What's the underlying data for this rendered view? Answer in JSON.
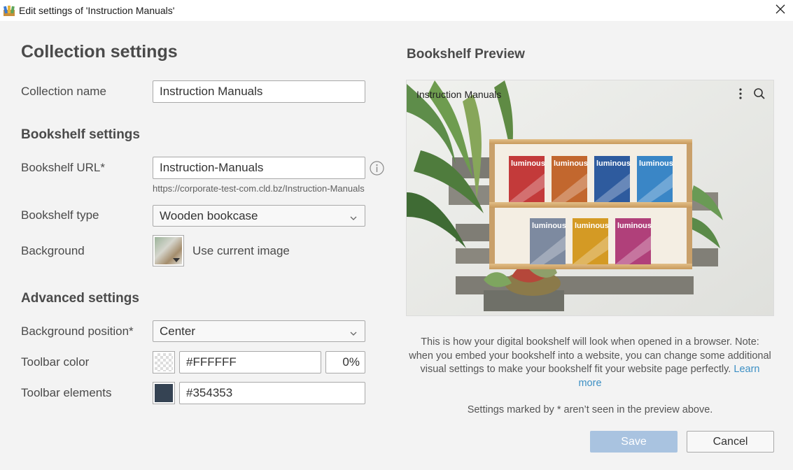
{
  "window": {
    "title": "Edit settings of 'Instruction Manuals'",
    "app_icon": "bookshelf-app-icon",
    "close_icon": "close-icon"
  },
  "form": {
    "heading": "Collection settings",
    "collection_name": {
      "label": "Collection name",
      "value": "Instruction Manuals"
    },
    "bookshelf_section": "Bookshelf settings",
    "bookshelf_url": {
      "label": "Bookshelf URL*",
      "value": "Instruction-Manuals",
      "helper": "https://corporate-test-com.cld.bz/Instruction-Manuals",
      "info_icon": "info-icon"
    },
    "bookshelf_type": {
      "label": "Bookshelf type",
      "value": "Wooden bookcase"
    },
    "background": {
      "label": "Background",
      "option": "Use current image"
    },
    "advanced_section": "Advanced settings",
    "background_position": {
      "label": "Background position*",
      "value": "Center"
    },
    "toolbar_color": {
      "label": "Toolbar color",
      "value": "#FFFFFF",
      "opacity": "0%",
      "swatch": "transparent"
    },
    "toolbar_elements": {
      "label": "Toolbar elements",
      "value": "#354353",
      "swatch": "#354353"
    }
  },
  "preview": {
    "heading": "Bookshelf Preview",
    "collection_name": "Instruction Manuals",
    "more_icon": "more-vertical-icon",
    "search_icon": "search-icon",
    "book_brand": "luminous",
    "book_colors_top": [
      "#c33a3a",
      "#c2672e",
      "#2e5b9e",
      "#3a86c6"
    ],
    "book_colors_bottom": [
      "#7d8aa0",
      "#d49a24",
      "#b0407a"
    ],
    "note": "This is how your digital bookshelf will look when opened in a browser. Note: when you embed your bookshelf into a website, you can change some additional visual settings to make your bookshelf fit your website page perfectly.",
    "learn_more": "Learn more",
    "settings_note": "Settings marked by * aren’t seen in the preview above."
  },
  "buttons": {
    "save": "Save",
    "cancel": "Cancel"
  }
}
